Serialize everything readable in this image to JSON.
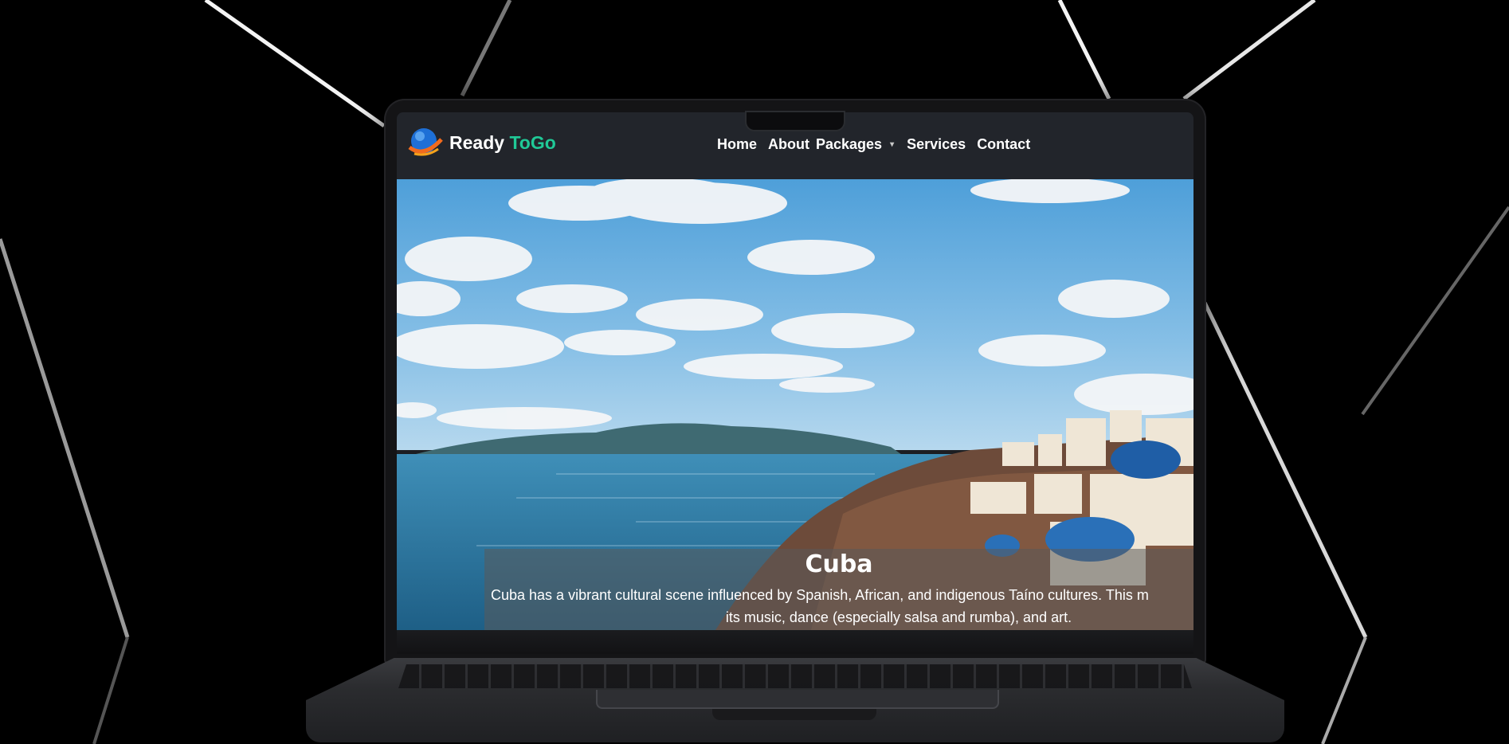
{
  "site": {
    "brand_primary": "Ready",
    "brand_accent": "ToGo",
    "accent_color": "#20c997"
  },
  "nav": {
    "items": [
      "Home",
      "About",
      "Packages",
      "Services",
      "Contact"
    ],
    "packages_caret": "▾"
  },
  "hero": {
    "title": "Cuba",
    "description_line1": "Cuba has a vibrant cultural scene influenced by Spanish, African, and indigenous Taíno cultures. This m",
    "description_line2": "its music, dance (especially salsa and rumba), and art."
  }
}
